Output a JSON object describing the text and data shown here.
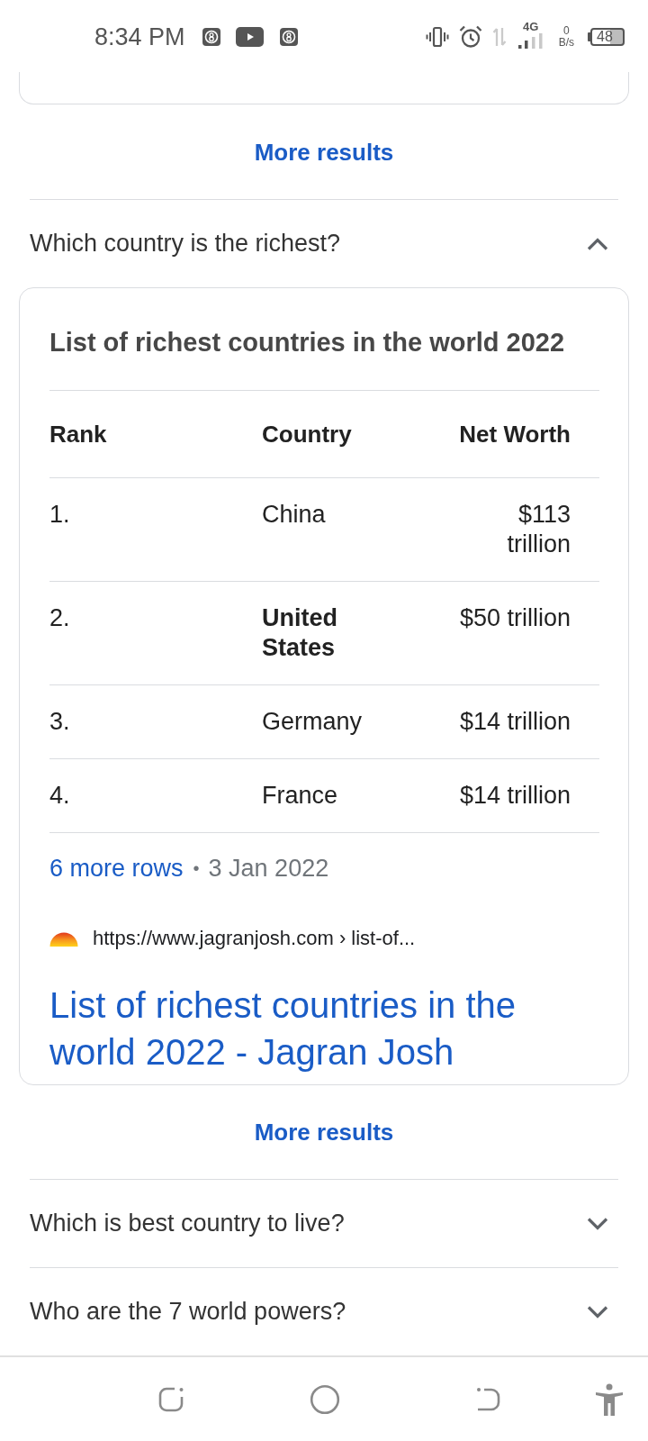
{
  "status_bar": {
    "time": "8:34 PM",
    "network_type": "4G",
    "data_speed": "0",
    "data_speed_unit": "B/s",
    "battery": "48"
  },
  "previous_result": {
    "more_results": "More results"
  },
  "questions": [
    {
      "question": "Which country is the richest?",
      "expanded": true,
      "answer": {
        "title": "List of richest countries in the world 2022",
        "table": {
          "columns": [
            "Rank",
            "Country",
            "Net Worth"
          ],
          "rows": [
            {
              "rank": "1.",
              "country": "China",
              "net_worth": "$113 trillion",
              "highlighted": false
            },
            {
              "rank": "2.",
              "country": "United States",
              "net_worth": "$50 trillion",
              "highlighted": true
            },
            {
              "rank": "3.",
              "country": "Germany",
              "net_worth": "$14 trillion",
              "highlighted": false
            },
            {
              "rank": "4.",
              "country": "France",
              "net_worth": "$14 trillion",
              "highlighted": false
            }
          ]
        },
        "more_rows": "6 more rows",
        "separator": "•",
        "date": "3 Jan 2022",
        "source_url": "https://www.jagranjosh.com › list-of...",
        "link_title": "List of richest countries in the world 2022 - Jagran Josh"
      },
      "more_results": "More results"
    },
    {
      "question": "Which is best country to live?",
      "expanded": false
    },
    {
      "question": "Who are the 7 world powers?",
      "expanded": false
    }
  ]
}
